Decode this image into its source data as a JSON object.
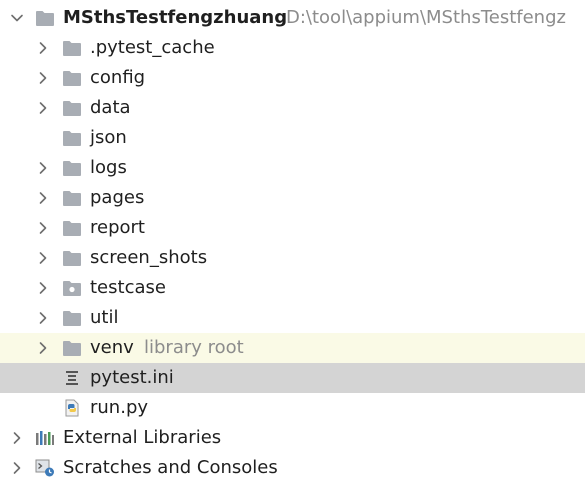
{
  "colors": {
    "folder": "#a8adb4",
    "chevron": "#6e6e6e",
    "hint": "#8c8c8c",
    "library_root_bg": "#fafae6",
    "selected_bg": "#d4d4d4",
    "python_blue": "#3d7ab8",
    "python_yellow": "#f2c94c"
  },
  "project": {
    "name": "MSthsTestfengzhuang",
    "path": "D:\\tool\\appium\\MSthsTestfengz",
    "icon": "folder-icon",
    "expanded": true
  },
  "children": [
    {
      "label": ".pytest_cache",
      "icon": "folder-icon",
      "has_chevron": true
    },
    {
      "label": "config",
      "icon": "folder-icon",
      "has_chevron": true
    },
    {
      "label": "data",
      "icon": "folder-icon",
      "has_chevron": true
    },
    {
      "label": "json",
      "icon": "folder-icon",
      "has_chevron": false
    },
    {
      "label": "logs",
      "icon": "folder-icon",
      "has_chevron": true
    },
    {
      "label": "pages",
      "icon": "folder-icon",
      "has_chevron": true
    },
    {
      "label": "report",
      "icon": "folder-icon",
      "has_chevron": true
    },
    {
      "label": "screen_shots",
      "icon": "folder-icon",
      "has_chevron": true
    },
    {
      "label": "testcase",
      "icon": "package-folder-icon",
      "has_chevron": true
    },
    {
      "label": "util",
      "icon": "folder-icon",
      "has_chevron": true
    },
    {
      "label": "venv",
      "hint": "library root",
      "icon": "folder-icon",
      "has_chevron": true,
      "highlight": "library-root"
    },
    {
      "label": "pytest.ini",
      "icon": "ini-file-icon",
      "has_chevron": false,
      "selected": true
    },
    {
      "label": "run.py",
      "icon": "python-file-icon",
      "has_chevron": false
    }
  ],
  "external_libraries": {
    "label": "External Libraries",
    "icon": "libraries-icon"
  },
  "scratches": {
    "label": "Scratches and Consoles",
    "icon": "scratches-icon"
  }
}
